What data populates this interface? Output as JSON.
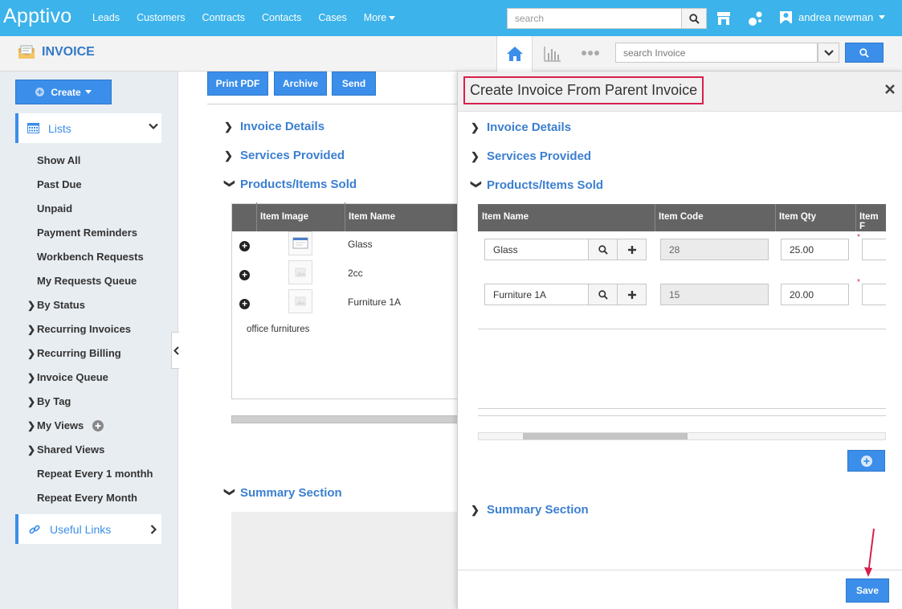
{
  "brand": {
    "logo": "Apptivo"
  },
  "nav": {
    "links": [
      "Leads",
      "Customers",
      "Contracts",
      "Contacts",
      "Cases"
    ],
    "more": "More",
    "search_placeholder": "search",
    "user_name": "andrea newman"
  },
  "app": {
    "title": "INVOICE",
    "search_placeholder": "search Invoice"
  },
  "sidebar": {
    "create_label": "Create",
    "lists_label": "Lists",
    "items": [
      "Show All",
      "Past Due",
      "Unpaid",
      "Payment Reminders",
      "Workbench Requests",
      "My Requests Queue"
    ],
    "expandable": [
      "By Status",
      "Recurring Invoices",
      "Recurring Billing",
      "Invoice Queue",
      "By Tag",
      "My Views",
      "Shared Views"
    ],
    "views": [
      "Repeat Every 1 monthh",
      "Repeat Every Month"
    ],
    "useful_links_label": "Useful Links"
  },
  "main": {
    "buttons": {
      "print_pdf": "Print PDF",
      "archive": "Archive",
      "send": "Send"
    },
    "sections": {
      "invoice_details": "Invoice Details",
      "services_provided": "Services Provided",
      "products_items_sold": "Products/Items Sold",
      "summary_section": "Summary Section"
    },
    "grid": {
      "col_item_image": "Item Image",
      "col_item_name": "Item Name",
      "rows": [
        "Glass",
        "2cc",
        "Furniture 1A"
      ],
      "note": "office furnitures"
    }
  },
  "overlay": {
    "title": "Create Invoice From Parent Invoice",
    "sections": {
      "invoice_details": "Invoice Details",
      "services_provided": "Services Provided",
      "products_items_sold": "Products/Items Sold",
      "summary_section": "Summary Section"
    },
    "grid": {
      "col_item_name": "Item Name",
      "col_item_code": "Item Code",
      "col_item_qty": "Item Qty",
      "col_item_price": "Item F",
      "rows": [
        {
          "name": "Glass",
          "code": "28",
          "qty": "25.00"
        },
        {
          "name": "Furniture 1A",
          "code": "15",
          "qty": "20.00"
        }
      ]
    },
    "required_mark": "*",
    "save_label": "Save"
  },
  "colors": {
    "nav_bg": "#3cb3ea",
    "accent": "#3b8ee9",
    "highlight": "#d81f4d"
  }
}
